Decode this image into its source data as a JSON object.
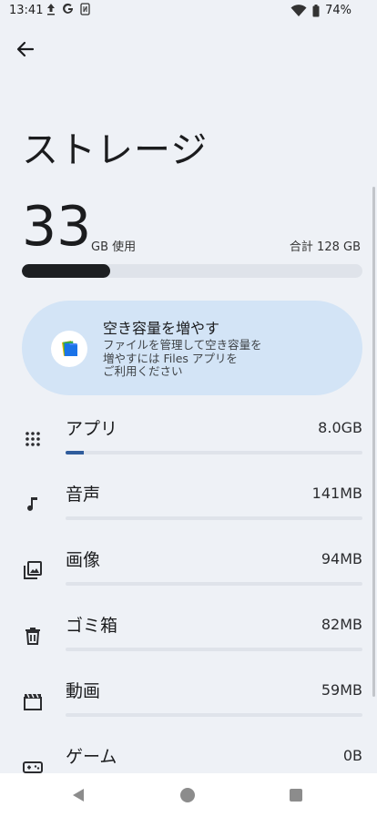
{
  "status_bar": {
    "time": "13:41",
    "battery": "74%",
    "left_icons": [
      "upload-icon",
      "google-icon",
      "nfc-icon"
    ],
    "right_icons": [
      "wifi-icon",
      "battery-icon"
    ]
  },
  "header": {
    "back_icon": "arrow-back-icon",
    "title": "ストレージ"
  },
  "summary": {
    "used_value": "33",
    "used_unit": "GB 使用",
    "total": "合計 128 GB",
    "used_fraction": 0.26
  },
  "promo": {
    "title": "空き容量を増やす",
    "description": "ファイルを管理して空き容量を\n増やすには Files アプリを\nご利用ください",
    "icon": "files-app-icon"
  },
  "categories": [
    {
      "label": "アプリ",
      "size": "8.0GB",
      "icon": "apps-grid-icon",
      "fraction": 0.06
    },
    {
      "label": "音声",
      "size": "141MB",
      "icon": "music-note-icon",
      "fraction": 0.0
    },
    {
      "label": "画像",
      "size": "94MB",
      "icon": "photo-library-icon",
      "fraction": 0.0
    },
    {
      "label": "ゴミ箱",
      "size": "82MB",
      "icon": "trash-icon",
      "fraction": 0.0
    },
    {
      "label": "動画",
      "size": "59MB",
      "icon": "movie-icon",
      "fraction": 0.0
    },
    {
      "label": "ゲーム",
      "size": "0B",
      "icon": "gamepad-icon",
      "fraction": 0.0
    }
  ],
  "colors": {
    "background": "#eef1f6",
    "usage_fill": "#1d1f22",
    "accent": "#2f5c9c",
    "promo_bg": "#d3e4f6"
  }
}
